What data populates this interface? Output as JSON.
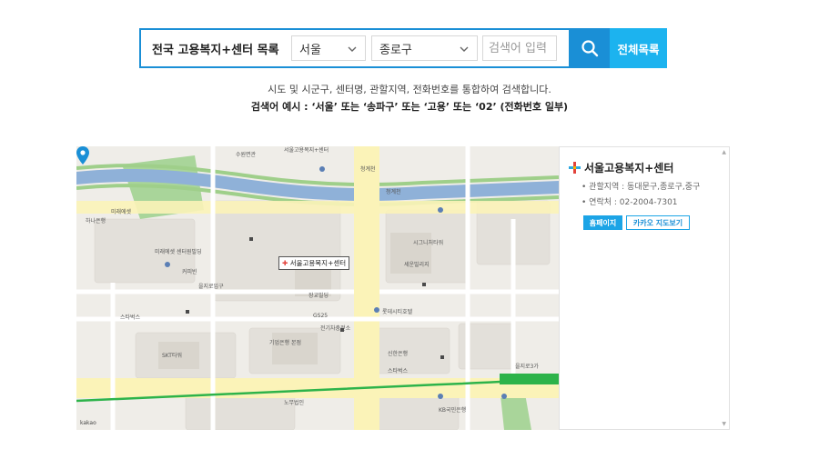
{
  "search": {
    "title": "전국 고용복지+센터 목록",
    "city_selected": "서울",
    "district_selected": "종로구",
    "placeholder": "검색어 입력",
    "all_list_label": "전체목록"
  },
  "help": {
    "line1": "시도 및 시군구, 센터명, 관할지역, 전화번호를 통합하여 검색합니다.",
    "line2": "검색어 예시 : ‘서울’ 또는 ‘송파구’ 또는 ‘고용’ 또는 ‘02’ (전화번호 일부)"
  },
  "map": {
    "pin_label": "서울고용복지+센터",
    "attribution": "kakao",
    "labels": {
      "l1": "수원면관",
      "l2": "서울고용복지+센터",
      "l3": "청계천",
      "l4": "SKT타워",
      "l5": "시그니처타워",
      "l6": "세운빌리지",
      "l7": "기업은행 본점",
      "l8": "전기차충전소",
      "l9": "GS25",
      "l10": "장교빌딩",
      "l11": "미래에셋 센터원빌딩",
      "l12": "커피빈",
      "l13": "을지로입구",
      "l14": "하나은행",
      "l15": "신한은행",
      "l16": "스타벅스",
      "l17": "청계천",
      "l18": "롯데시티호텔",
      "l19": "KB국민은행",
      "l20": "을지로3가",
      "l21": "스타벅스",
      "l22": "미래에셋",
      "l23": "노무법인"
    }
  },
  "panel": {
    "center_name": "서울고용복지+센터",
    "jurisdiction": "• 관할지역 : 동대문구,종로구,중구",
    "phone": "• 연락처 : 02-2004-7301",
    "homepage_label": "홈페이지",
    "kakao_map_label": "카카오 지도보기"
  },
  "colors": {
    "primary": "#1a8fd6",
    "accent": "#1cb3ef",
    "stream": "#8fb1d8",
    "park": "#a9d59a",
    "subway_line": "#2db34a",
    "road": "#fbf3b8"
  }
}
